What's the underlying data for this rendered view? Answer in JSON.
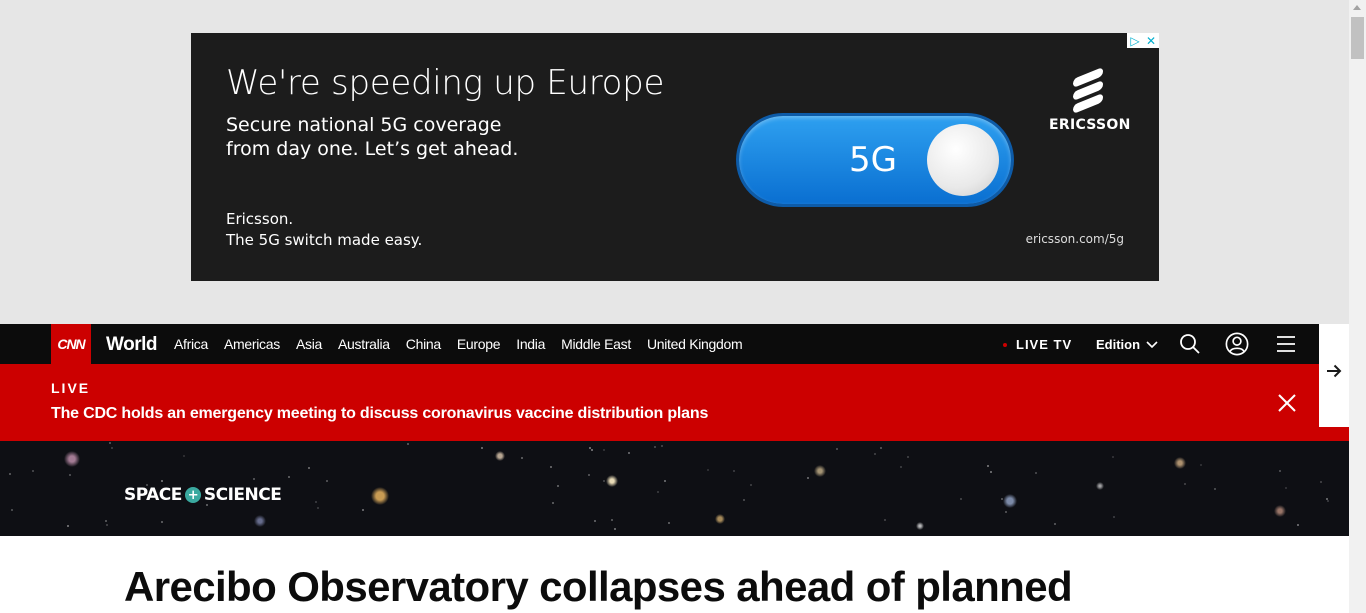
{
  "ad": {
    "headline": "We're speeding up Europe",
    "subheadline": "Secure national 5G coverage from day one. Let’s get ahead.",
    "brand_line_1": "Ericsson.",
    "brand_line_2": "The 5G switch made easy.",
    "toggle_label": "5G",
    "logo_text": "ERICSSON",
    "url": "ericsson.com/5g",
    "adchoices_icon": "adchoices-icon",
    "close_glyph": "✕",
    "play_glyph": "▷"
  },
  "nav": {
    "logo": "CNN",
    "section": "World",
    "links": [
      "Africa",
      "Americas",
      "Asia",
      "Australia",
      "China",
      "Europe",
      "India",
      "Middle East",
      "United Kingdom"
    ],
    "live_tv": "LIVE TV",
    "edition": "Edition"
  },
  "live_banner": {
    "label": "LIVE",
    "headline": "The CDC holds an emergency meeting to discuss coronavirus vaccine distribution plans"
  },
  "hero": {
    "logo_left": "SPACE",
    "logo_plus": "+",
    "logo_right": "SCIENCE"
  },
  "article": {
    "title": "Arecibo Observatory collapses ahead of planned"
  },
  "colors": {
    "cnn_red": "#cc0000",
    "nav_bg": "#0c0c0c",
    "ad_bg": "#1c1c1c",
    "toggle_blue": "#0a6fd1",
    "space_accent": "#3aa9a0"
  }
}
